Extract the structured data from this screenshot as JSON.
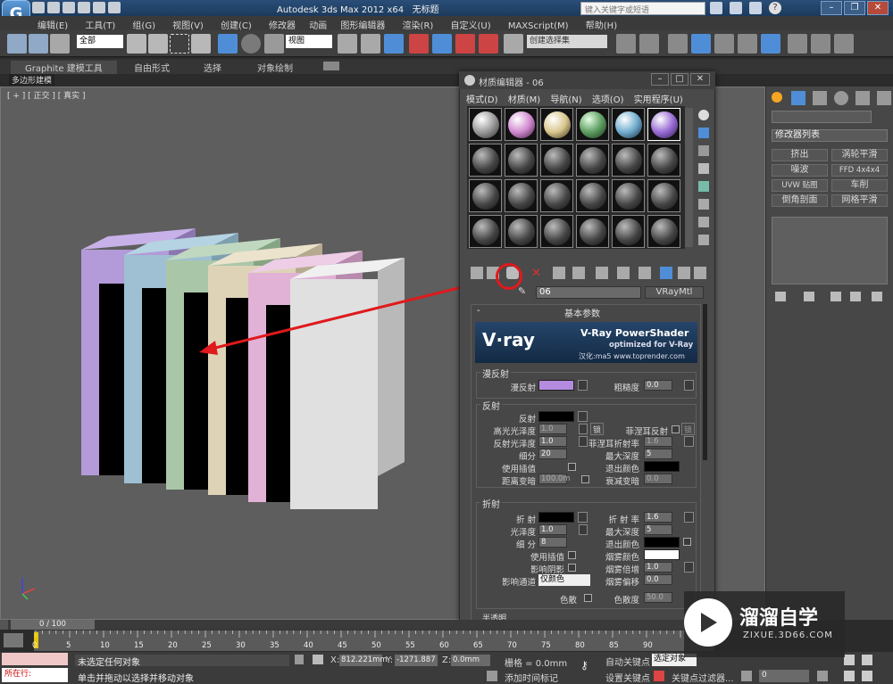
{
  "title_bar": {
    "app_title": "Autodesk 3ds Max  2012 x64",
    "doc_title": "无标题",
    "search_placeholder": "键入关键字或短语",
    "menu": [
      "编辑(E)",
      "工具(T)",
      "组(G)",
      "视图(V)",
      "创建(C)",
      "修改器",
      "动画",
      "图形编辑器",
      "渲染(R)",
      "自定义(U)",
      "MAXScript(M)",
      "帮助(H)"
    ]
  },
  "main_toolbar": {
    "selection_filter": "全部",
    "ref_coord": "视图",
    "named_selection": "创建选择集"
  },
  "ribbon": {
    "tabs": [
      "Graphite 建模工具",
      "自由形式",
      "选择",
      "对象绘制"
    ],
    "sub_label": "多边形建模"
  },
  "viewport": {
    "label": "[ + ] [ 正交 ] [ 真实 ]"
  },
  "command_panel": {
    "modifier_list": "修改器列表",
    "buttons": [
      "挤出",
      "涡轮平滑",
      "噪波",
      "FFD 4x4x4",
      "UVW 贴图",
      "车削",
      "倒角剖面",
      "网格平滑"
    ]
  },
  "material_editor": {
    "title": "材质编辑器 - 06",
    "menu": [
      "模式(D)",
      "材质(M)",
      "导航(N)",
      "选项(O)",
      "实用程序(U)"
    ],
    "material_name": "06",
    "material_type": "VRayMtl",
    "rollout_title": "基本参数",
    "vray_banner": {
      "brand": "V·ray",
      "product": "V-Ray PowerShader",
      "tagline": "optimized for V-Ray",
      "credit": "汉化:ma5  www.toprender.com"
    },
    "diffuse": {
      "group": "漫反射",
      "label": "漫反射",
      "roughness_label": "粗糙度",
      "roughness": "0.0",
      "color": "#b58be0"
    },
    "reflection": {
      "group": "反射",
      "reflect_label": "反射",
      "hilight_gloss_label": "高光光泽度",
      "hilight_gloss": "1.0",
      "lock_label": "锁",
      "fresnel_label": "菲涅耳反射",
      "refl_gloss_label": "反射光泽度",
      "refl_gloss": "1.0",
      "fresnel_ior_label": "菲涅耳折射率",
      "fresnel_ior": "1.6",
      "subdivs_label": "细分",
      "subdivs": "20",
      "max_depth_label": "最大深度",
      "max_depth": "5",
      "use_interp_label": "使用插值",
      "exit_color_label": "退出颜色",
      "dim_dist_label": "距离变暗",
      "dim_dist": "100.0m",
      "dim_falloff_label": "衰减变暗",
      "dim_falloff": "0.0"
    },
    "refraction": {
      "group": "折射",
      "refract_label": "折 射",
      "ior_label": "折 射 率",
      "ior": "1.6",
      "gloss_label": "光泽度",
      "gloss": "1.0",
      "max_depth_label": "最大深度",
      "max_depth": "5",
      "subdivs_label": "细 分",
      "subdivs": "8",
      "exit_color_label": "退出颜色",
      "use_interp_label": "使用插值",
      "fog_color_label": "烟雾颜色",
      "affect_shadows_label": "影响阴影",
      "fog_mult_label": "烟雾倍增",
      "fog_mult": "1.0",
      "affect_channels_label": "影响通道",
      "affect_channels": "仅颜色",
      "fog_bias_label": "烟雾偏移",
      "fog_bias": "0.0",
      "dispersion_label": "色散",
      "abbe_label": "色散度",
      "abbe": "50.0"
    },
    "next_rollout": "半透明"
  },
  "timeline": {
    "frame_counter": "0 / 100",
    "ticks": [
      "0",
      "5",
      "10",
      "15",
      "20",
      "25",
      "30",
      "35",
      "40",
      "45",
      "50",
      "55",
      "60",
      "65",
      "70",
      "75",
      "80",
      "85",
      "90"
    ]
  },
  "status_bar": {
    "maxscript_label": "所在行:",
    "status_text": "未选定任何对象",
    "prompt_text": "单击并拖动以选择并移动对象",
    "x_label": "X:",
    "x_value": "812.221mm",
    "y_label": "Y:",
    "y_value": "-1271.887",
    "z_label": "Z:",
    "z_value": "0.0mm",
    "grid_label": "栅格 = 0.0mm",
    "add_time_tag": "添加时间标记",
    "auto_key": "自动关键点",
    "auto_key_value": "选定对象",
    "set_key": "设置关键点",
    "key_filters": "关键点过滤器...",
    "frame_field": "0"
  },
  "watermark": {
    "brand": "溜溜自学",
    "url": "ZIXUE.3D66.COM"
  },
  "colors": {
    "panel_purple": "#b39ad8",
    "panel_blue": "#9ec0d2",
    "panel_green": "#a9c7a8",
    "panel_beige": "#dfd3b7",
    "panel_pink": "#e1b2d6",
    "panel_white": "#e0e0e0",
    "annotation_red": "#e0191c"
  }
}
